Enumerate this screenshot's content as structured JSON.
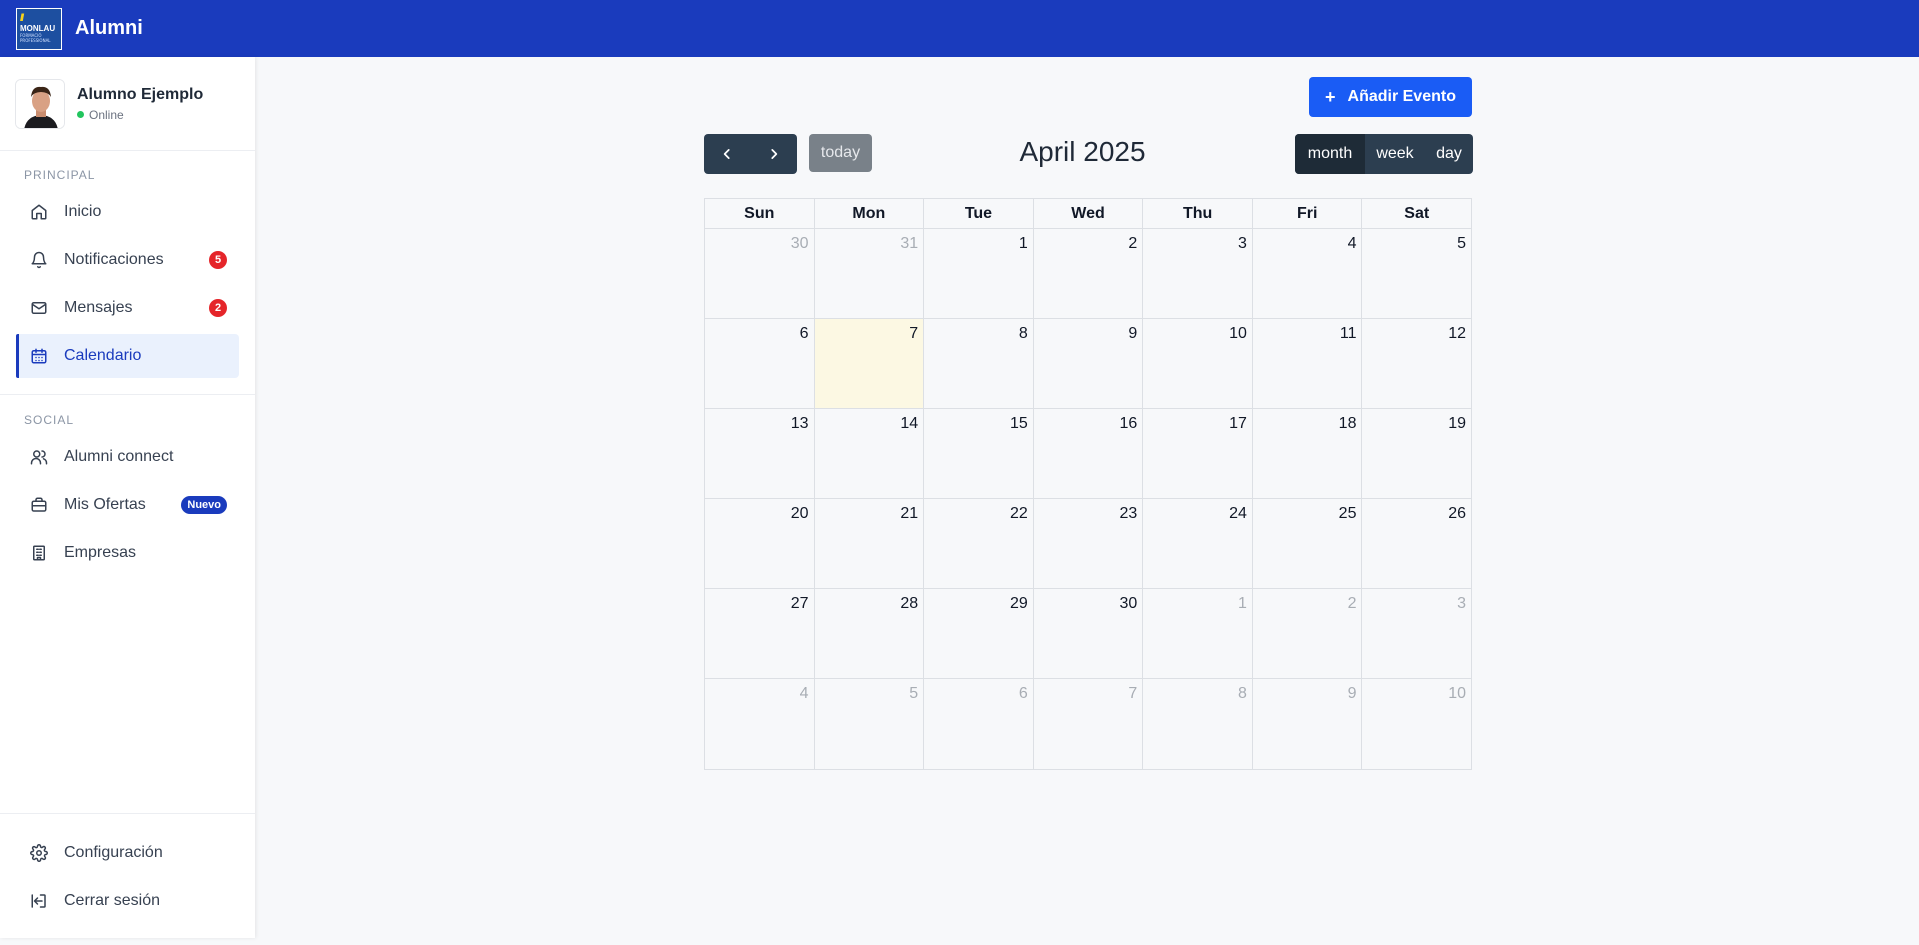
{
  "header": {
    "app_title": "Alumni",
    "logo_name": "MONLAU",
    "logo_sub": "FORMACIÓ PROFESSIONAL"
  },
  "profile": {
    "name": "Alumno Ejemplo",
    "status": "Online"
  },
  "sidebar": {
    "sections": [
      {
        "label": "PRINCIPAL"
      },
      {
        "label": "SOCIAL"
      }
    ],
    "items": [
      {
        "label": "Inicio",
        "icon": "home-icon"
      },
      {
        "label": "Notificaciones",
        "icon": "bell-icon",
        "badge": "5"
      },
      {
        "label": "Mensajes",
        "icon": "mail-icon",
        "badge": "2"
      },
      {
        "label": "Calendario",
        "icon": "calendar-icon",
        "active": true
      },
      {
        "label": "Alumni connect",
        "icon": "users-icon"
      },
      {
        "label": "Mis Ofertas",
        "icon": "briefcase-icon",
        "badge": "Nuevo"
      },
      {
        "label": "Empresas",
        "icon": "building-icon"
      }
    ],
    "footer": [
      {
        "label": "Configuración",
        "icon": "gear-icon"
      },
      {
        "label": "Cerrar sesión",
        "icon": "logout-icon"
      }
    ]
  },
  "toolbar": {
    "add_event": "Añadir Evento",
    "today": "today",
    "title": "April 2025"
  },
  "views": [
    "month",
    "week",
    "day"
  ],
  "calendar": {
    "weekdays": [
      "Sun",
      "Mon",
      "Tue",
      "Wed",
      "Thu",
      "Fri",
      "Sat"
    ],
    "weeks": [
      [
        "30",
        "31",
        "1",
        "2",
        "3",
        "4",
        "5"
      ],
      [
        "6",
        "7",
        "8",
        "9",
        "10",
        "11",
        "12"
      ],
      [
        "13",
        "14",
        "15",
        "16",
        "17",
        "18",
        "19"
      ],
      [
        "20",
        "21",
        "22",
        "23",
        "24",
        "25",
        "26"
      ],
      [
        "27",
        "28",
        "29",
        "30",
        "1",
        "2",
        "3"
      ],
      [
        "4",
        "5",
        "6",
        "7",
        "8",
        "9",
        "10"
      ]
    ]
  },
  "colors": {
    "brand": "#1a3bbd",
    "accent_button": "#1a5cf5",
    "today_highlight": "#fcf8e3",
    "badge_red": "#e5252a"
  }
}
